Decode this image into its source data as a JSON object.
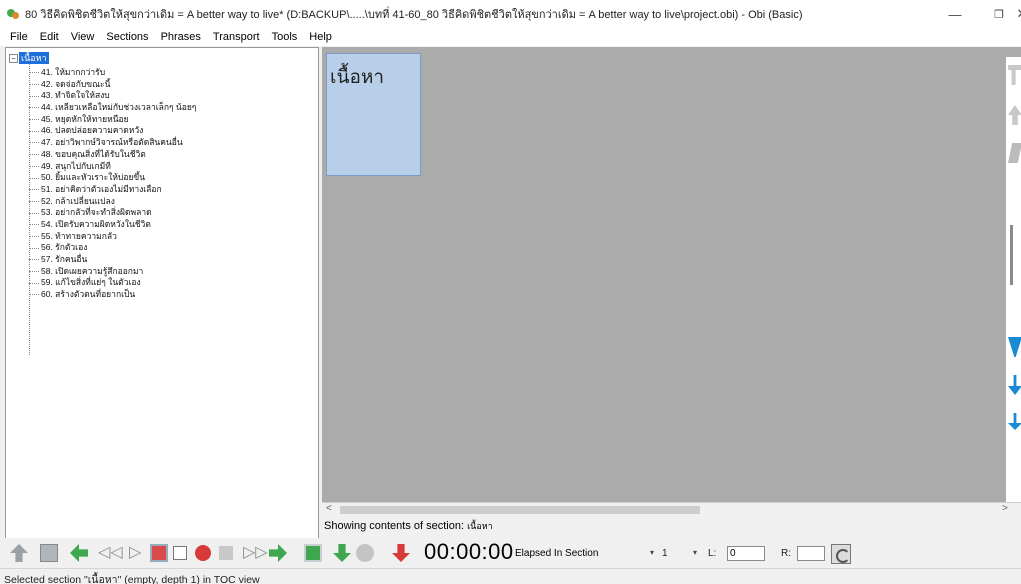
{
  "window": {
    "title": "80 วิธีคิดพิชิตชีวิตให้สุขกว่าเดิม = A better way to live* (D:BACKUP\\.....\\บทที่ 41-60_80 วิธีคิดพิชิตชีวิตให้สุขกว่าเดิม = A better way to live\\project.obi) - Obi (Basic)",
    "minimize_icon": "minimize-icon",
    "maximize_icon": "restore-icon",
    "close_icon": "close-icon",
    "min_glyph": "—",
    "max_glyph": "❐",
    "close_glyph": "✕"
  },
  "menu": {
    "items": [
      "File",
      "Edit",
      "View",
      "Sections",
      "Phrases",
      "Transport",
      "Tools",
      "Help"
    ]
  },
  "toc": {
    "root": "เนื้อหา",
    "expander": "−",
    "items": [
      "41. ให้มากกว่ารับ",
      "42. จดจ่อกับขณะนี้",
      "43. ทำจิตใจให้สงบ",
      "44. เหลียวเหลือใหม่กับช่วงเวลาเล็กๆ น้อยๆ",
      "45. หยุดหักให้ทายหนือย",
      "46. ปลดปล่อยความคาดหวัง",
      "47. อย่าวิพากษ์วิจารณ์หรือตัดสินคนอื่น",
      "48. ขอบคุณสิ่งที่ได้รับในชีวิต",
      "49. สนุกไปกับเกมีที",
      "50. ยิ้มและหัวเราะให้บ่อยขึ้น",
      "51. อย่าคิดว่าตัวเองไม่มีทางเลือก",
      "52. กล้าเปลี่ยนแปลง",
      "53. อย่ากลัวที่จะทำสิ่งผิดพลาด",
      "54. เปิดรับความผิดหวังในชีวิต",
      "55. ท้าทายความกลัว",
      "56. รักตัวเอง",
      "57. รักคนอื่น",
      "58. เปิดเผยความรู้สึกออกมา",
      "59. แก้ไขสิ่งที่แย่ๆ ในตัวเอง",
      "60. สร้างตัวตนที่อยากเป็น"
    ]
  },
  "content": {
    "section_strip_label": "เนื้อหา",
    "showing_prefix": "Showing contents of section:",
    "showing_section": "เนื้อหา",
    "scroll_left": "<",
    "scroll_right": ">"
  },
  "transport": {
    "time": "00:00:00",
    "time_mode": "Elapsed In Section",
    "level_value": "1",
    "dropdown_arrow": "▾",
    "l_label": "L:",
    "l_value": "0",
    "r_label": "R:",
    "r_value": ""
  },
  "status": {
    "text": "Selected section \"เนื้อหา\" (empty, depth 1) in TOC view"
  },
  "colors": {
    "accent_blue": "#1e6fd9",
    "green": "#3fa84f",
    "red": "#d83a3a",
    "strip_bg": "#b8cfe9",
    "content_bg": "#ababab"
  }
}
